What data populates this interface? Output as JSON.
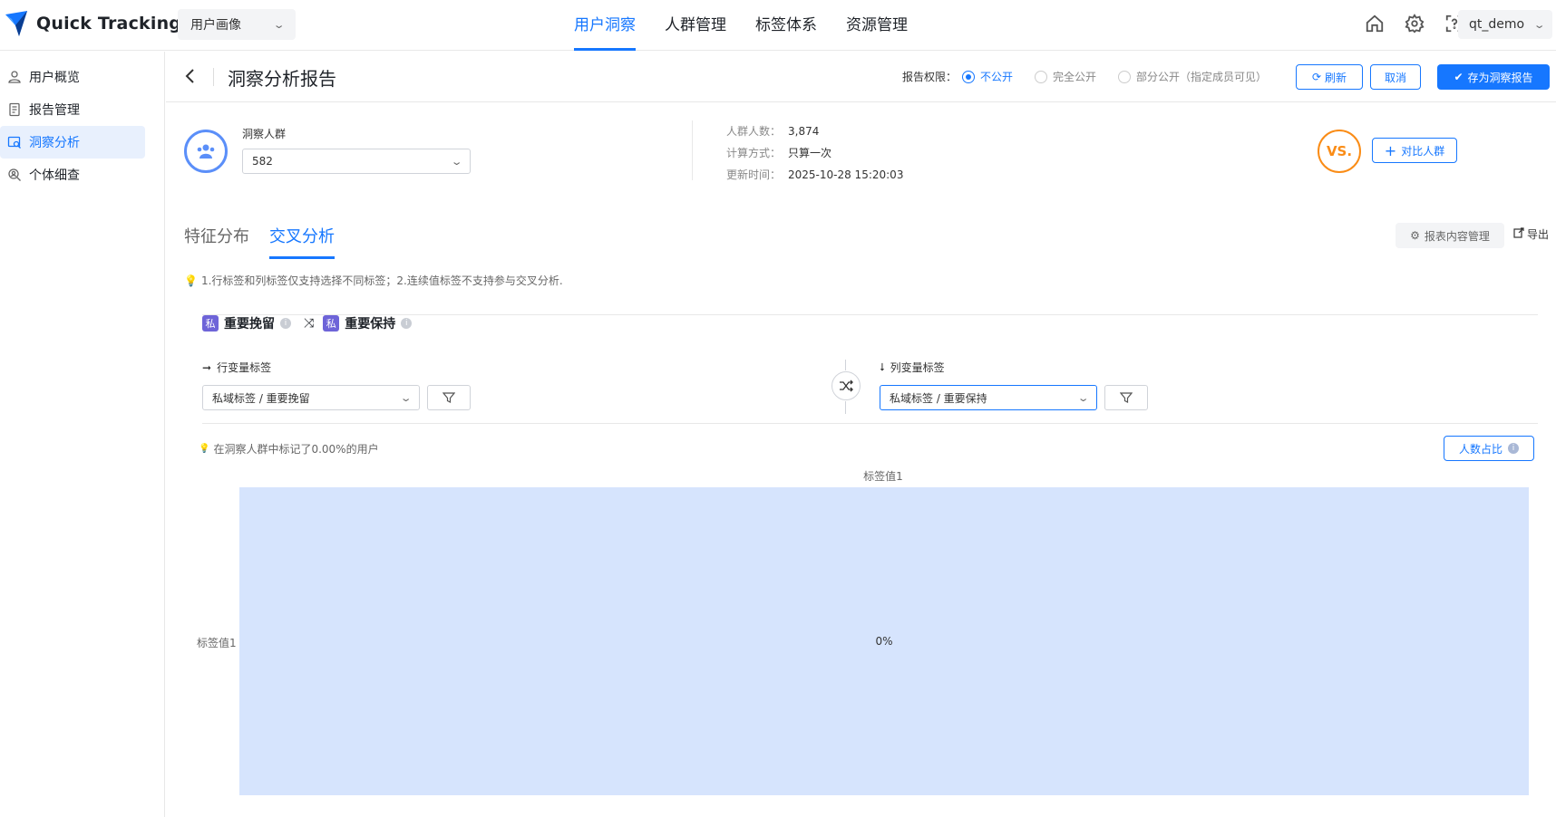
{
  "app": {
    "name": "Quick Tracking",
    "module_select": "用户画像",
    "user": "qt_demo"
  },
  "topnav": [
    {
      "label": "用户洞察",
      "active": true
    },
    {
      "label": "人群管理",
      "active": false
    },
    {
      "label": "标签体系",
      "active": false
    },
    {
      "label": "资源管理",
      "active": false
    }
  ],
  "sidebar": {
    "items": [
      {
        "label": "用户概览",
        "icon": "user-overview-icon",
        "active": false
      },
      {
        "label": "报告管理",
        "icon": "report-icon",
        "active": false
      },
      {
        "label": "洞察分析",
        "icon": "insight-icon",
        "active": true
      },
      {
        "label": "个体细查",
        "icon": "person-search-icon",
        "active": false
      }
    ]
  },
  "page": {
    "title": "洞察分析报告",
    "permission_label": "报告权限：",
    "permission_options": [
      "不公开",
      "完全公开",
      "部分公开（指定成员可见）"
    ],
    "permission_selected": "不公开",
    "refresh": "刷新",
    "cancel": "取消",
    "save": "存为洞察报告"
  },
  "crowd": {
    "label": "洞察人群",
    "selected": "582",
    "count_label": "人群人数：",
    "count": "3,874",
    "calc_label": "计算方式：",
    "calc": "只算一次",
    "updated_label": "更新时间：",
    "updated": "2025-10-28 15:20:03",
    "vs": "VS.",
    "compare": "对比人群"
  },
  "tabs": {
    "feature": "特征分布",
    "cross": "交叉分析",
    "active": "交叉分析"
  },
  "tools": {
    "report_manage": "报表内容管理",
    "export": "导出"
  },
  "tip": "1.行标签和列标签仅支持选择不同标签；2.连续值标签不支持参与交叉分析.",
  "cross": {
    "priv_badge": "私",
    "row_tag": "重要挽留",
    "col_tag": "重要保持",
    "row_var_label": "行变量标签",
    "col_var_label": "列变量标签",
    "row_select": "私域标签 / 重要挽留",
    "col_select": "私域标签 / 重要保持",
    "marked": "在洞察人群中标记了0.00%的用户",
    "ratio_btn": "人数占比"
  },
  "chart_data": {
    "type": "heatmap",
    "columns": [
      "标签值1"
    ],
    "rows": [
      "标签值1"
    ],
    "values": [
      [
        0
      ]
    ],
    "cell_labels": [
      [
        "0%"
      ]
    ],
    "cell_color": "#d6e4fd"
  },
  "colors": {
    "accent": "#1677ff",
    "vs": "#fa8c16",
    "priv_badge": "#6e64d8"
  }
}
